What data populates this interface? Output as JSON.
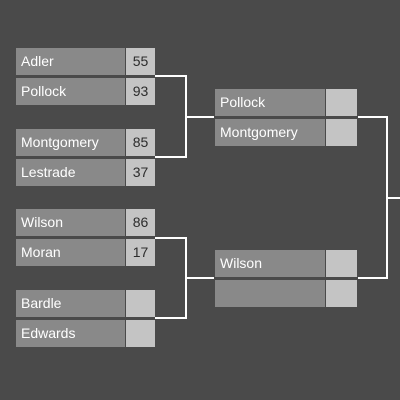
{
  "bracket": {
    "round1": [
      {
        "team": "Adler",
        "score": "55"
      },
      {
        "team": "Pollock",
        "score": "93"
      },
      {
        "team": "Montgomery",
        "score": "85"
      },
      {
        "team": "Lestrade",
        "score": "37"
      },
      {
        "team": "Wilson",
        "score": "86"
      },
      {
        "team": "Moran",
        "score": "17"
      },
      {
        "team": "Bardle",
        "score": ""
      },
      {
        "team": "Edwards",
        "score": ""
      }
    ],
    "round2": [
      {
        "team": "Pollock",
        "score": ""
      },
      {
        "team": "Montgomery",
        "score": ""
      },
      {
        "team": "Wilson",
        "score": ""
      },
      {
        "team": "",
        "score": ""
      }
    ]
  }
}
